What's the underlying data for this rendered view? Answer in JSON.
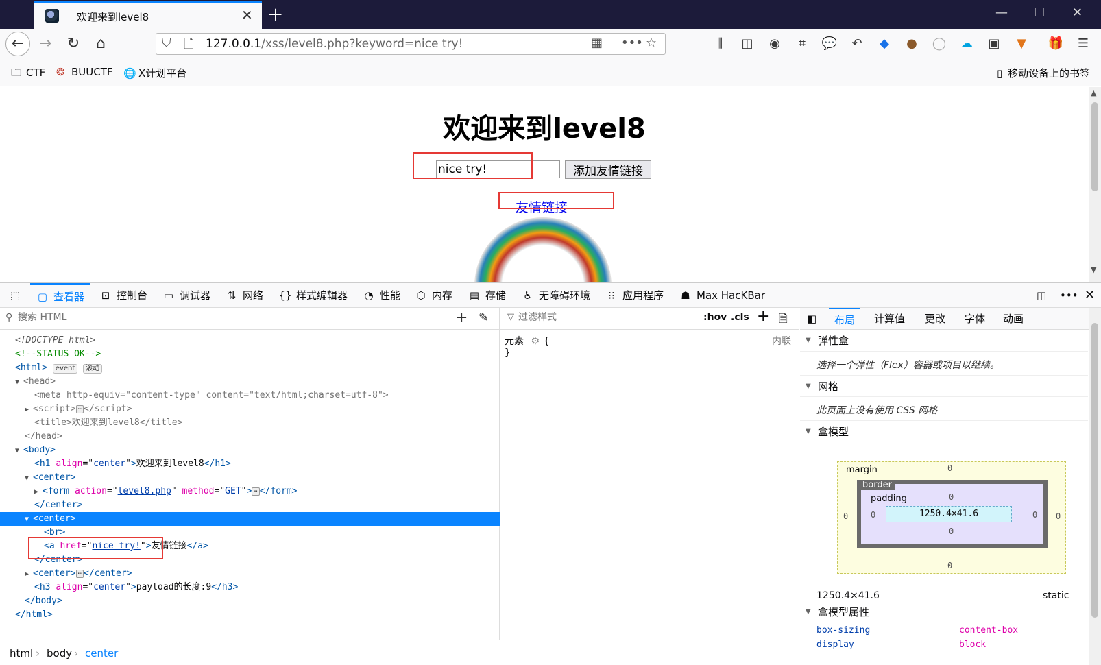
{
  "browser": {
    "tab_title": "欢迎来到level8",
    "url_host": "127.0.0.1",
    "url_path": "/xss/level8.php?keyword=nice try!",
    "bookmarks": [
      "CTF",
      "BUUCTF",
      "X计划平台"
    ],
    "mobile_bookmarks": "移动设备上的书签"
  },
  "page": {
    "heading": "欢迎来到level8",
    "keyword_value": "nice try!",
    "submit_label": "添加友情链接",
    "link_text": "友情链接"
  },
  "devtools": {
    "tabs": [
      "查看器",
      "控制台",
      "调试器",
      "网络",
      "样式编辑器",
      "性能",
      "内存",
      "存储",
      "无障碍环境",
      "应用程序",
      "Max HacKBar"
    ],
    "search_placeholder": "搜索 HTML",
    "markup": {
      "doctype": "<!DOCTYPE html>",
      "comment": "<!--STATUS OK-->",
      "html_badges": [
        "event",
        "滚动"
      ],
      "meta_http_equiv": "content-type",
      "meta_content": "text/html;charset=utf-8",
      "title_text": "欢迎来到level8",
      "h1_align": "center",
      "h1_text": "欢迎来到level8",
      "form_action": "level8.php",
      "form_method": "GET",
      "a_href": "nice try!",
      "a_text": "友情链接",
      "h3_align": "center",
      "h3_text": "payload的长度:9"
    },
    "breadcrumbs": [
      "html",
      "body",
      "center"
    ],
    "rules": {
      "filter_placeholder": "过滤样式",
      "hov": ":hov",
      "cls": ".cls",
      "element_label": "元素",
      "inline_label": "内联"
    },
    "layout": {
      "tabs": [
        "布局",
        "计算值",
        "更改",
        "字体",
        "动画"
      ],
      "flex_title": "弹性盒",
      "flex_note": "选择一个弹性（Flex）容器或项目以继续。",
      "grid_title": "网格",
      "grid_note": "此页面上没有使用 CSS 网格",
      "box_title": "盒模型",
      "margin_label": "margin",
      "border_label": "border",
      "padding_label": "padding",
      "content_size": "1250.4×41.6",
      "zero": "0",
      "dimensions": "1250.4×41.6",
      "position": "static",
      "props_title": "盒模型属性",
      "props": [
        {
          "name": "box-sizing",
          "value": "content-box"
        },
        {
          "name": "display",
          "value": "block"
        }
      ]
    }
  },
  "colors": {
    "accent": "#0a84ff",
    "highlight_box": "#e53935",
    "titlebar": "#1c1b3a"
  }
}
